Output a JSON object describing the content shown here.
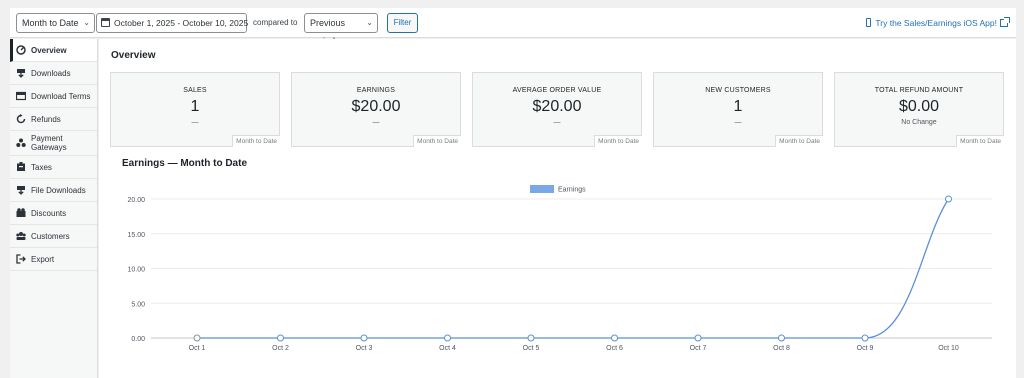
{
  "toolbar": {
    "range_select": "Month to Date",
    "date_range": "October 1, 2025 - October 10, 2025",
    "compared_label": "compared to",
    "compare_select": "Previous period",
    "filter_button": "Filter",
    "ios_link": "Try the Sales/Earnings iOS App!"
  },
  "sidebar": {
    "items": [
      {
        "label": "Overview",
        "icon": "dashboard-icon",
        "active": true
      },
      {
        "label": "Downloads",
        "icon": "download-icon"
      },
      {
        "label": "Download Terms",
        "icon": "terms-icon"
      },
      {
        "label": "Refunds",
        "icon": "refund-icon"
      },
      {
        "label": "Payment\nGateways",
        "icon": "gateways-icon"
      },
      {
        "label": "Taxes",
        "icon": "taxes-icon"
      },
      {
        "label": "File Downloads",
        "icon": "file-download-icon"
      },
      {
        "label": "Discounts",
        "icon": "discounts-icon"
      },
      {
        "label": "Customers",
        "icon": "customers-icon"
      },
      {
        "label": "Export",
        "icon": "export-icon"
      }
    ]
  },
  "overview": {
    "title": "Overview",
    "cards": [
      {
        "label": "SALES",
        "value": "1",
        "change": "—",
        "period": "Month to Date"
      },
      {
        "label": "EARNINGS",
        "value": "$20.00",
        "change": "—",
        "period": "Month to Date"
      },
      {
        "label": "AVERAGE ORDER VALUE",
        "value": "$20.00",
        "change": "—",
        "period": "Month to Date"
      },
      {
        "label": "NEW CUSTOMERS",
        "value": "1",
        "change": "—",
        "period": "Month to Date"
      },
      {
        "label": "TOTAL REFUND AMOUNT",
        "value": "$0.00",
        "change": "No Change",
        "period": "Month to Date"
      }
    ]
  },
  "chart_title": "Earnings — Month to Date",
  "colors": {
    "accent": "#2271b1",
    "line": "#5b8fd6",
    "legend": "#7ba7e8"
  },
  "chart_data": {
    "type": "line",
    "title": "Earnings — Month to Date",
    "x": [
      "Oct 1",
      "Oct 2",
      "Oct 3",
      "Oct 4",
      "Oct 5",
      "Oct 6",
      "Oct 7",
      "Oct 8",
      "Oct 9",
      "Oct 10"
    ],
    "series": [
      {
        "name": "Earnings",
        "values": [
          0,
          0,
          0,
          0,
          0,
          0,
          0,
          0,
          0,
          20
        ]
      }
    ],
    "yticks": [
      "0.00",
      "5.00",
      "10.00",
      "15.00",
      "20.00"
    ],
    "ylim": [
      0,
      20
    ],
    "xlabel": "",
    "ylabel": "",
    "grid": true,
    "legend": "top-center"
  }
}
